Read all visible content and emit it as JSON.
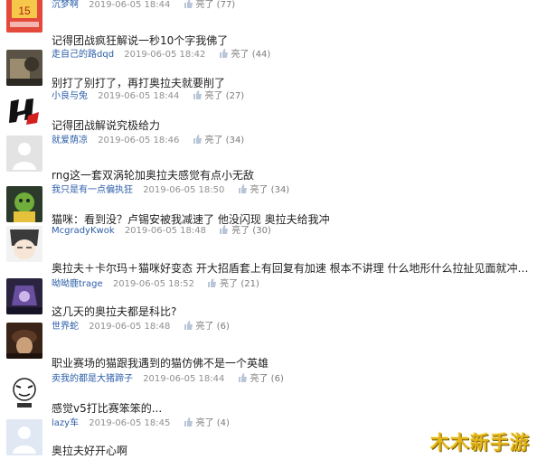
{
  "rows": [
    {
      "user": "沉梦啊",
      "time": "2019-06-05 18:44",
      "likes": "亮了 (77)",
      "comment": ""
    },
    {
      "user": "走自己的路dqd",
      "time": "2019-06-05 18:42",
      "likes": "亮了 (44)",
      "comment": "记得团战疯狂解说一秒10个字我佛了"
    },
    {
      "user": "小良与兔",
      "time": "2019-06-05 18:44",
      "likes": "亮了 (27)",
      "comment": "别打了别打了，再打奥拉夫就要削了"
    },
    {
      "user": "就爱荫凉",
      "time": "2019-06-05 18:46",
      "likes": "亮了 (34)",
      "comment": "记得团战解说究极给力"
    },
    {
      "user": "我只是有一点偏执狂",
      "time": "2019-06-05 18:50",
      "likes": "亮了 (34)",
      "comment": "rng这一套双涡轮加奥拉夫感觉有点小无敌"
    },
    {
      "user": "McgradyKwok",
      "time": "2019-06-05 18:48",
      "likes": "亮了 (30)",
      "comment": "猫咪：看到没？卢锡安被我减速了 他没闪现 奥拉夫给我冲"
    },
    {
      "user": "呦呦鹿trage",
      "time": "2019-06-05 18:52",
      "likes": "亮了 (21)",
      "comment": "奥拉夫＋卡尔玛＋猫咪好变态 开大招盾套上有回复有加速 根本不讲理 什么地形什么拉扯见面就冲阵..."
    },
    {
      "user": "世界蛇",
      "time": "2019-06-05 18:48",
      "likes": "亮了 (6)",
      "comment": "这几天的奥拉夫都是科比?"
    },
    {
      "user": "卖我的都是大猪蹄子",
      "time": "2019-06-05 18:44",
      "likes": "亮了 (6)",
      "comment": "职业赛场的猫跟我遇到的猫仿佛不是一个英雄"
    },
    {
      "user": "lazy车",
      "time": "2019-06-05 18:45",
      "likes": "亮了 (4)",
      "comment": "感觉v5打比赛笨笨的..."
    },
    {
      "user": "",
      "time": "",
      "likes": "",
      "comment": "奥拉夫好开心啊"
    }
  ],
  "avatars": [
    "red-game-avatar",
    "dark-photo-avatar",
    "hot-logo-avatar",
    "default-avatar",
    "green-character-avatar",
    "anime-face-avatar",
    "purple-character-avatar",
    "dark-scene-avatar",
    "meme-face-avatar",
    "default-avatar-blue"
  ],
  "watermark": "木木新手游",
  "colors": {
    "username": "#2c5ea8",
    "meta": "#8f8f8f",
    "watermark": "#e2b51a"
  }
}
